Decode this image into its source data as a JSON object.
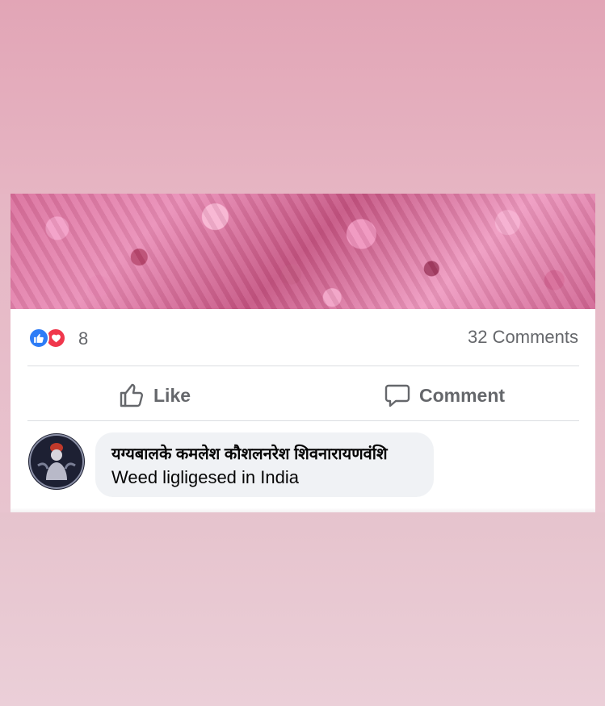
{
  "post": {
    "reactions": {
      "count": "8",
      "icons": [
        "like-icon",
        "love-icon"
      ]
    },
    "comments_count": "32 Comments",
    "actions": {
      "like_label": "Like",
      "comment_label": "Comment"
    }
  },
  "comment": {
    "author": "यग्यबालके कमलेश कौशलनरेश शिवनारायणवंशि",
    "text": "Weed ligligesed in India"
  },
  "colors": {
    "like_blue": "#2d7cf6",
    "love_red": "#f0374c",
    "secondary_text": "#65676b",
    "bubble_bg": "#f0f2f5",
    "background_pink": "#e2a7b7"
  }
}
